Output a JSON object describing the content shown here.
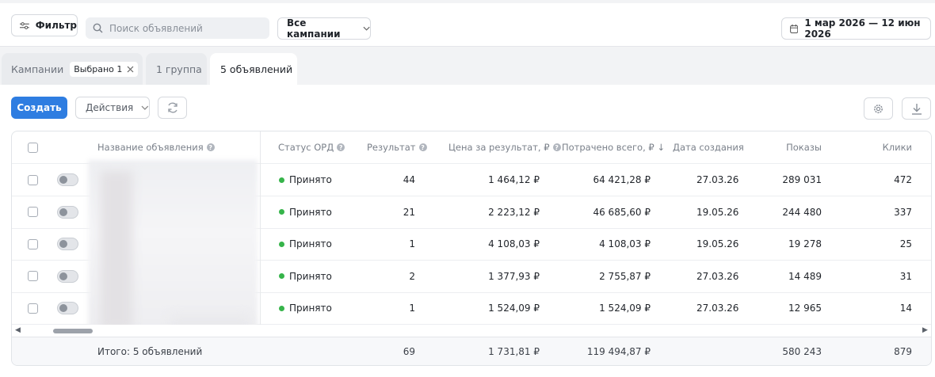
{
  "toolbar": {
    "filter_label": "Фильтр",
    "search_placeholder": "Поиск объявлений",
    "campaigns_select": "Все кампании",
    "date_range": "1 мар 2026 — 12 июн 2026"
  },
  "tabs": {
    "campaigns_label": "Кампании",
    "selected_chip": "Выбрано 1",
    "group_label": "1 группа",
    "ads_label": "5 объявлений"
  },
  "actions": {
    "create_label": "Создать",
    "actions_label": "Действия"
  },
  "table": {
    "headers": {
      "name": "Название объявления",
      "ord_status": "Статус ОРД",
      "result": "Результат",
      "price_per_result": "Цена за результат, ₽",
      "spent_total": "Потрачено всего, ₽ ↓",
      "created": "Дата создания",
      "impressions": "Показы",
      "clicks": "Клики"
    },
    "rows": [
      {
        "status": "Принято",
        "result": "44",
        "price": "1 464,12 ₽",
        "spent": "64 421,28 ₽",
        "created": "27.03.26",
        "impressions": "289 031",
        "clicks": "472"
      },
      {
        "status": "Принято",
        "result": "21",
        "price": "2 223,12 ₽",
        "spent": "46 685,60 ₽",
        "created": "19.05.26",
        "impressions": "244 480",
        "clicks": "337"
      },
      {
        "status": "Принято",
        "result": "1",
        "price": "4 108,03 ₽",
        "spent": "4 108,03 ₽",
        "created": "19.05.26",
        "impressions": "19 278",
        "clicks": "25"
      },
      {
        "status": "Принято",
        "result": "2",
        "price": "1 377,93 ₽",
        "spent": "2 755,87 ₽",
        "created": "27.03.26",
        "impressions": "14 489",
        "clicks": "31"
      },
      {
        "status": "Принято",
        "result": "1",
        "price": "1 524,09 ₽",
        "spent": "1 524,09 ₽",
        "created": "27.03.26",
        "impressions": "12 965",
        "clicks": "14"
      }
    ],
    "totals": {
      "label": "Итого: 5 объявлений",
      "result": "69",
      "price": "1 731,81 ₽",
      "spent": "119 494,87 ₽",
      "impressions": "580 243",
      "clicks": "879"
    }
  },
  "colors": {
    "accent": "#2e7de1",
    "status_ok": "#36b44a"
  }
}
